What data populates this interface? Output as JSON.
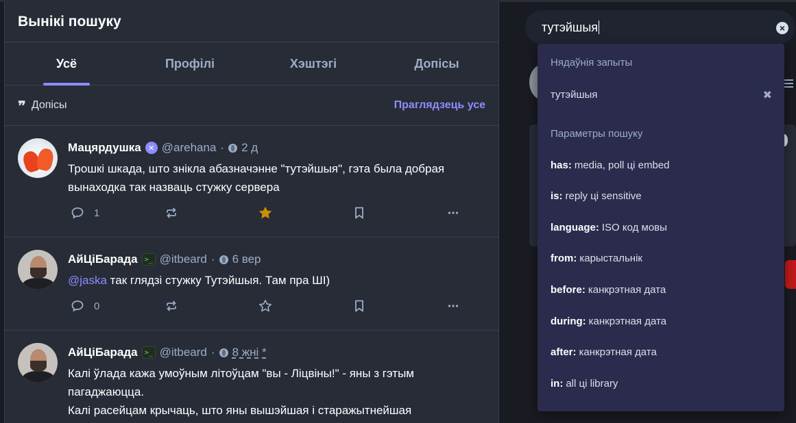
{
  "column": {
    "title": "Вынікі пошуку",
    "tabs": [
      {
        "label": "Усё",
        "active": true
      },
      {
        "label": "Профілі",
        "active": false
      },
      {
        "label": "Хэштэгі",
        "active": false
      },
      {
        "label": "Допісы",
        "active": false
      }
    ],
    "section": {
      "icon": "quote-icon",
      "label": "Допісы",
      "see_all": "Праглядзець усе"
    }
  },
  "posts": [
    {
      "display_name": "Мацярдушка",
      "badge": "✕",
      "handle": "@arehana",
      "separator": "·",
      "visibility_icon": "globe-icon",
      "time": "2 д",
      "body": "Трошкі шкада, што знікла абазначэнне \"тутэйшыя\", гэта была добрая вынаходка так назваць стужку сервера",
      "replies": "1",
      "favourited": true
    },
    {
      "display_name": "АйЦіБарада",
      "badge": ">_",
      "handle": "@itbeard",
      "separator": "·",
      "visibility_icon": "globe-icon",
      "time": "6 вер",
      "mention": "@jaska",
      "body": " так глядзі стужку Тутэйшыя. Там пра ШІ)",
      "replies": "0",
      "favourited": false
    },
    {
      "display_name": "АйЦіБарада",
      "badge": ">_",
      "handle": "@itbeard",
      "separator": "·",
      "visibility_icon": "globe-icon",
      "time": "8 жні *",
      "body_line1": "Калі ўлада кажа умоўным літоўцам \"вы - Ліцвіны!\" - яны з гэтым пагаджаюцца.",
      "body_line2": "Калі расейцам крычаць, што яны вышэйшая і старажытнейшая"
    }
  ],
  "search": {
    "value": "тутэйшыя",
    "clear_icon": "×"
  },
  "dropdown": {
    "recent_heading": "Нядаўнія запыты",
    "recent": [
      {
        "label": "тутэйшыя",
        "remove_icon": "✖"
      }
    ],
    "options_heading": "Параметры пошуку",
    "options": [
      {
        "key": "has:",
        "desc": "media, poll ці embed"
      },
      {
        "key": "is:",
        "desc": "reply ці sensitive"
      },
      {
        "key": "language:",
        "desc": "ISO код мовы"
      },
      {
        "key": "from:",
        "desc": "карыстальнік"
      },
      {
        "key": "before:",
        "desc": "канкрэтная дата"
      },
      {
        "key": "during:",
        "desc": "канкрэтная дата"
      },
      {
        "key": "after:",
        "desc": "канкрэтная дата"
      },
      {
        "key": "in:",
        "desc": "all ці library"
      }
    ]
  },
  "colors": {
    "accent": "#8c8dff",
    "favourite": "#ca8f04",
    "background": "#191b22",
    "column": "#282c37",
    "dropdown": "#2b2b4d"
  }
}
